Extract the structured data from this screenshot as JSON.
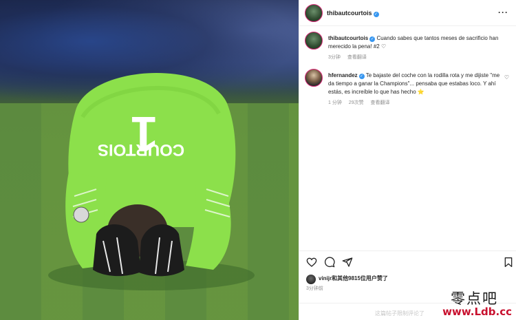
{
  "post": {
    "username": "thibautcourtois",
    "caption_text": "Cuando sabes que tantos meses de sacrificio han merecido la pena! #2 ♡",
    "caption_time": "3分钟",
    "caption_translate": "查看翻译"
  },
  "comment": {
    "username": "hfernandez",
    "text": "Te bajaste del coche con la rodilla rota y me dijiste \"me da tiempo a ganar la Champions\"... pensaba que estabas loco. Y ahí estás, es increíble lo que has hecho ⭐",
    "time": "1 分钟",
    "likes": "29次赞",
    "translate": "查看翻译"
  },
  "likes_line": "vinijr和其他9815位用户赞了",
  "post_time": "3分钟前",
  "comment_limit": "这篇帖子限制评论了",
  "watermark": {
    "cn": "零点吧",
    "url": "www.Ldb.cc"
  },
  "icons": {
    "verified": "verified-badge-icon",
    "more": "more-options-icon",
    "like": "heart-icon",
    "comment": "comment-icon",
    "share": "send-icon",
    "save": "bookmark-icon"
  },
  "photo": {
    "jersey_number": "1",
    "jersey_name": "COURTOIS"
  },
  "colors": {
    "accent": "#3897f0",
    "jersey": "#8ce04b",
    "watermark_red": "#c8102e"
  }
}
